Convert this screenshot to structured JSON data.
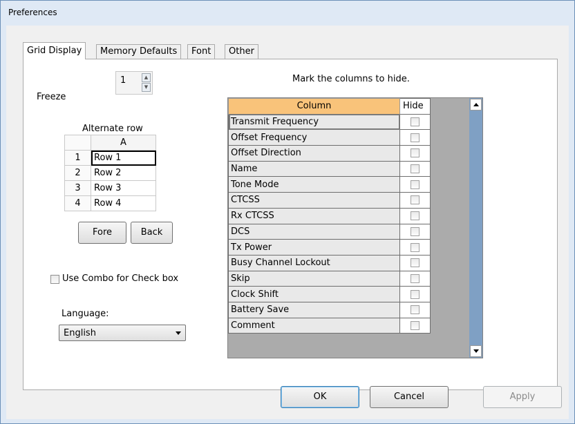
{
  "window": {
    "title": "Preferences"
  },
  "tabs": [
    {
      "label": "Grid Display"
    },
    {
      "label": "Memory Defaults"
    },
    {
      "label": "Font"
    },
    {
      "label": "Other"
    }
  ],
  "freeze": {
    "label": "Freeze",
    "value": "1"
  },
  "alternate_row": {
    "title": "Alternate row",
    "column_header": "A",
    "rows": [
      {
        "num": "1",
        "label": "Row 1"
      },
      {
        "num": "2",
        "label": "Row 2"
      },
      {
        "num": "3",
        "label": "Row 3"
      },
      {
        "num": "4",
        "label": "Row 4"
      }
    ],
    "fore_label": "Fore",
    "back_label": "Back"
  },
  "combo_checkbox": {
    "label": "Use Combo for Check box",
    "checked": false
  },
  "language": {
    "label": "Language:",
    "value": "English"
  },
  "hide_columns": {
    "instruction": "Mark the columns to hide.",
    "header_column": "Column",
    "header_hide": "Hide",
    "rows": [
      {
        "name": "Transmit Frequency",
        "hidden": false
      },
      {
        "name": "Offset Frequency",
        "hidden": false
      },
      {
        "name": "Offset Direction",
        "hidden": false
      },
      {
        "name": "Name",
        "hidden": false
      },
      {
        "name": "Tone Mode",
        "hidden": false
      },
      {
        "name": "CTCSS",
        "hidden": false
      },
      {
        "name": "Rx CTCSS",
        "hidden": false
      },
      {
        "name": "DCS",
        "hidden": false
      },
      {
        "name": "Tx Power",
        "hidden": false
      },
      {
        "name": "Busy Channel Lockout",
        "hidden": false
      },
      {
        "name": "Skip",
        "hidden": false
      },
      {
        "name": "Clock Shift",
        "hidden": false
      },
      {
        "name": "Battery Save",
        "hidden": false
      },
      {
        "name": "Comment",
        "hidden": false
      }
    ]
  },
  "buttons": {
    "ok": "OK",
    "cancel": "Cancel",
    "apply": "Apply"
  },
  "colors": {
    "header_accent": "#f9c37a",
    "scrollbar": "#7fa0c4",
    "grid_bg": "#ababab"
  }
}
